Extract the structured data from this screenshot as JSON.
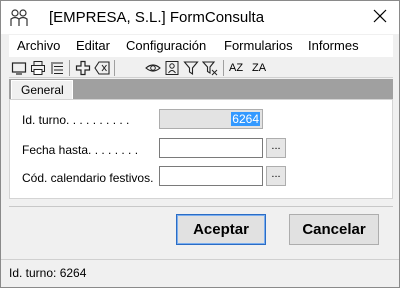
{
  "window": {
    "title": "[EMPRESA, S.L.] FormConsulta"
  },
  "menu": [
    "Archivo",
    "Editar",
    "Configuración",
    "Formularios",
    "Informes"
  ],
  "toolbar": {
    "icons": [
      "screen-icon",
      "print-icon",
      "list-icon",
      "add-icon",
      "delete-icon",
      "view-icon",
      "record-icon",
      "filter-icon",
      "clear-filter-icon",
      "sort-asc-icon",
      "sort-desc-icon"
    ],
    "sort_asc_label": "AZ",
    "sort_desc_label": "ZA"
  },
  "tabs": [
    {
      "label": "General",
      "active": true
    }
  ],
  "form": {
    "fields": [
      {
        "label": "Id. turno. . . . . . . . . .",
        "value": "6264",
        "selected": true,
        "has_button": false
      },
      {
        "label": "Fecha hasta. . . . . . . .",
        "value": "",
        "has_button": true,
        "button_label": "..."
      },
      {
        "label": "Cód. calendario festivos.",
        "value": "",
        "has_button": true,
        "button_label": "..."
      }
    ]
  },
  "buttons": {
    "accept": "Aceptar",
    "cancel": "Cancelar"
  },
  "status": {
    "text": "Id. turno: 6264"
  },
  "colors": {
    "selection": "#3399ff",
    "tabstrip": "#a0a0a0",
    "default_button_border": "#2b6cc4"
  }
}
